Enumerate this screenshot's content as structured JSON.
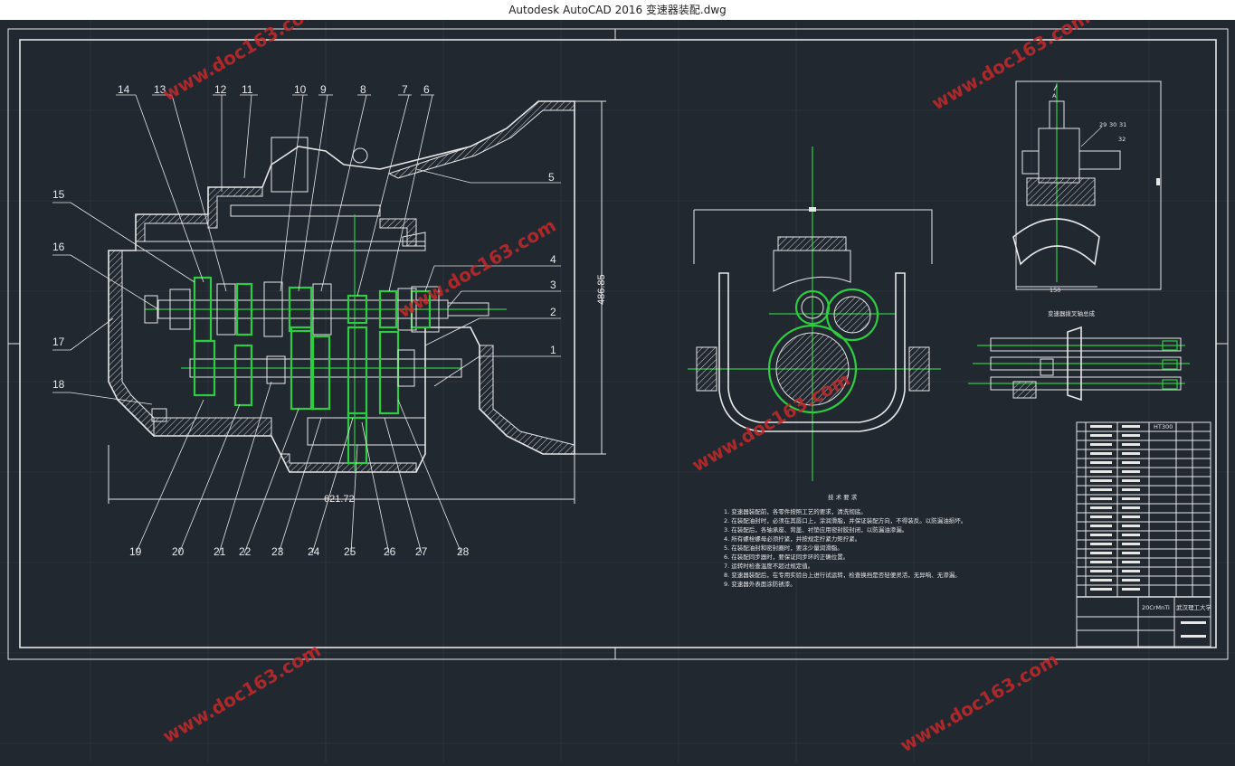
{
  "window": {
    "title": "Autodesk AutoCAD 2016     变速器装配.dwg"
  },
  "watermark": {
    "text": "www.doc163.com"
  },
  "drawing": {
    "part_numbers": {
      "top": [
        "14",
        "13",
        "12",
        "11",
        "10",
        "9",
        "8",
        "7",
        "6"
      ],
      "right": [
        "5",
        "4",
        "3",
        "2",
        "1"
      ],
      "left": [
        "15",
        "16",
        "17",
        "18"
      ],
      "bottom": [
        "19",
        "20",
        "21",
        "22",
        "23",
        "24",
        "25",
        "26",
        "27",
        "28"
      ]
    },
    "dimensions": {
      "width": "621.72",
      "height": "486.85"
    },
    "fork_assembly_title": "变速器拨叉轴总成",
    "fork_part_numbers": [
      "29",
      "30",
      "31",
      "32"
    ],
    "fork_dim": "150",
    "fork_view_mark": "A",
    "tech_req_title": "技 术 要 求",
    "tech_req_lines": [
      "1. 变速器装配前，各零件按照工艺的要求，清洗彻底。",
      "2. 在装配油封时，必须在其唇口上，涂润滑脂，并保证装配方向，不得装反。以防漏油损坏。",
      "3. 在装配后，各轴承座、背盖、衬垫应用密封胶封闭，以防漏油渗漏。",
      "4. 所有螺栓螺母必须拧紧，并按规定拧紧力矩拧紧。",
      "5. 在装配油封和密封圈时，要涂少量润滑脂。",
      "6. 在装配同步器时，要保证同步环的正确位置。",
      "7. 运转时检查温度不超过规定值。",
      "8. 变速器装配后，在专用实验台上进行试运转，检查换挡是否轻便灵活，无异响、无渗漏。",
      "9. 变速器外表面涂防锈漆。"
    ],
    "title_block": {
      "material": "20CrMnTi",
      "school": "武汉理工大学",
      "header_code": "HT300"
    }
  }
}
